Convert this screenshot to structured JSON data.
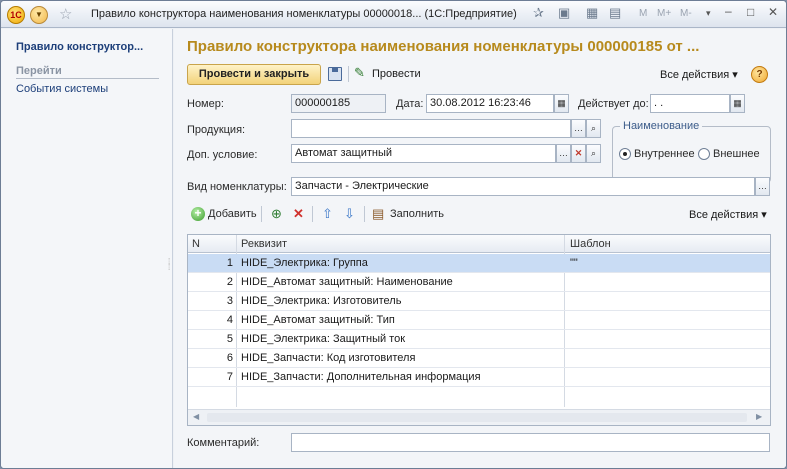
{
  "window": {
    "title": "Правило конструктора наименования номенклатуры 00000018...  (1С:Предприятие)",
    "logo_text": "1С",
    "m_buttons": [
      "M",
      "M+",
      "M-"
    ]
  },
  "sidebar": {
    "title": "Правило конструктор...",
    "section": "Перейти",
    "items": [
      {
        "label": "События системы"
      }
    ]
  },
  "form": {
    "title": "Правило конструктора наименования номенклатуры 000000185 от ...",
    "toolbar": {
      "post_close": "Провести и закрыть",
      "post": "Провести",
      "all_actions": "Все действия",
      "help": "?"
    },
    "fields": {
      "number_label": "Номер:",
      "number_value": "000000185",
      "date_label": "Дата:",
      "date_value": "30.08.2012 16:23:46",
      "valid_label": "Действует до:",
      "valid_value": " .  .",
      "product_label": "Продукция:",
      "product_value": "",
      "cond_label": "Доп. условие:",
      "cond_value": "Автомат защитный",
      "kind_label": "Вид номенклатуры:",
      "kind_value": "Запчасти - Электрические",
      "comment_label": "Комментарий:",
      "comment_value": ""
    },
    "naming": {
      "title": "Наименование",
      "options": [
        "Внутреннее",
        "Внешнее"
      ],
      "selected": "Внутреннее"
    },
    "table_toolbar": {
      "add": "Добавить",
      "fill": "Заполнить",
      "all_actions": "Все действия"
    },
    "table": {
      "columns": [
        "N",
        "Реквизит",
        "Шаблон"
      ],
      "rows": [
        {
          "n": "1",
          "field": "HIDE_Электрика: Группа",
          "template": "\"\""
        },
        {
          "n": "2",
          "field": "HIDE_Автомат защитный: Наименование",
          "template": ""
        },
        {
          "n": "3",
          "field": "HIDE_Электрика: Изготовитель",
          "template": ""
        },
        {
          "n": "4",
          "field": "HIDE_Автомат защитный: Тип",
          "template": ""
        },
        {
          "n": "5",
          "field": "HIDE_Электрика: Защитный ток",
          "template": ""
        },
        {
          "n": "6",
          "field": "HIDE_Запчасти: Код изготовителя",
          "template": ""
        },
        {
          "n": "7",
          "field": "HIDE_Запчасти: Дополнительная информация",
          "template": ""
        }
      ],
      "selected_row": 1
    }
  }
}
